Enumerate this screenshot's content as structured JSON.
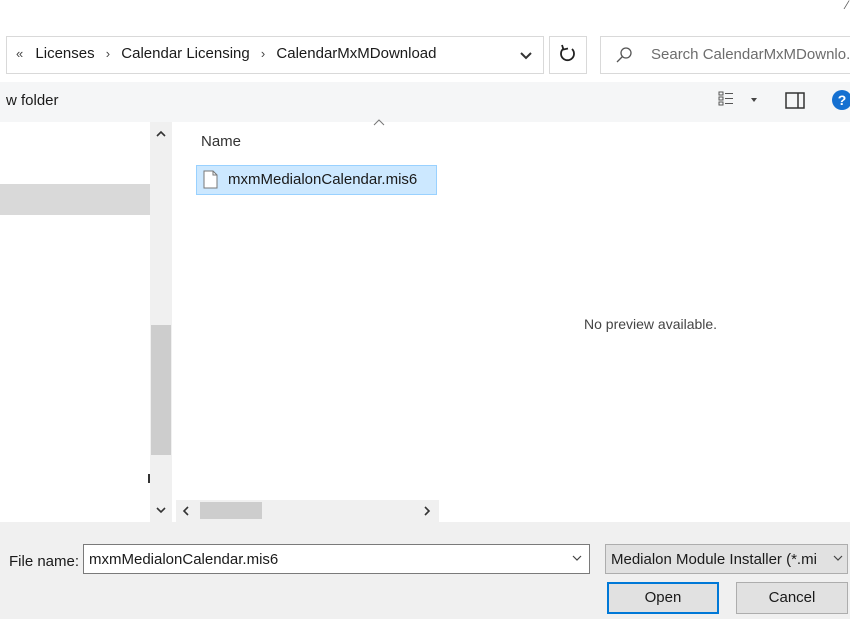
{
  "window": {
    "title_corner": "⁄"
  },
  "address_bar": {
    "overflow": "«",
    "crumbs": [
      "Licenses",
      "Calendar Licensing",
      "CalendarMxMDownload"
    ],
    "separator": "›"
  },
  "search": {
    "placeholder": "Search CalendarMxMDownlo..."
  },
  "toolbar": {
    "new_folder": "w folder",
    "help": "?"
  },
  "file_list": {
    "column_name": "Name",
    "items": [
      {
        "name": "mxmMedialonCalendar.mis6",
        "selected": true
      }
    ]
  },
  "preview": {
    "message": "No preview available."
  },
  "footer": {
    "file_name_label": "File name:",
    "file_name_value": "mxmMedialonCalendar.mis6",
    "file_type_value": "Medialon Module Installer (*.mi",
    "open_label": "Open",
    "cancel_label": "Cancel"
  },
  "colors": {
    "selection": "#cce8ff",
    "selection_border": "#99d1ff",
    "accent": "#0078d7",
    "help_icon": "#1570d1"
  }
}
